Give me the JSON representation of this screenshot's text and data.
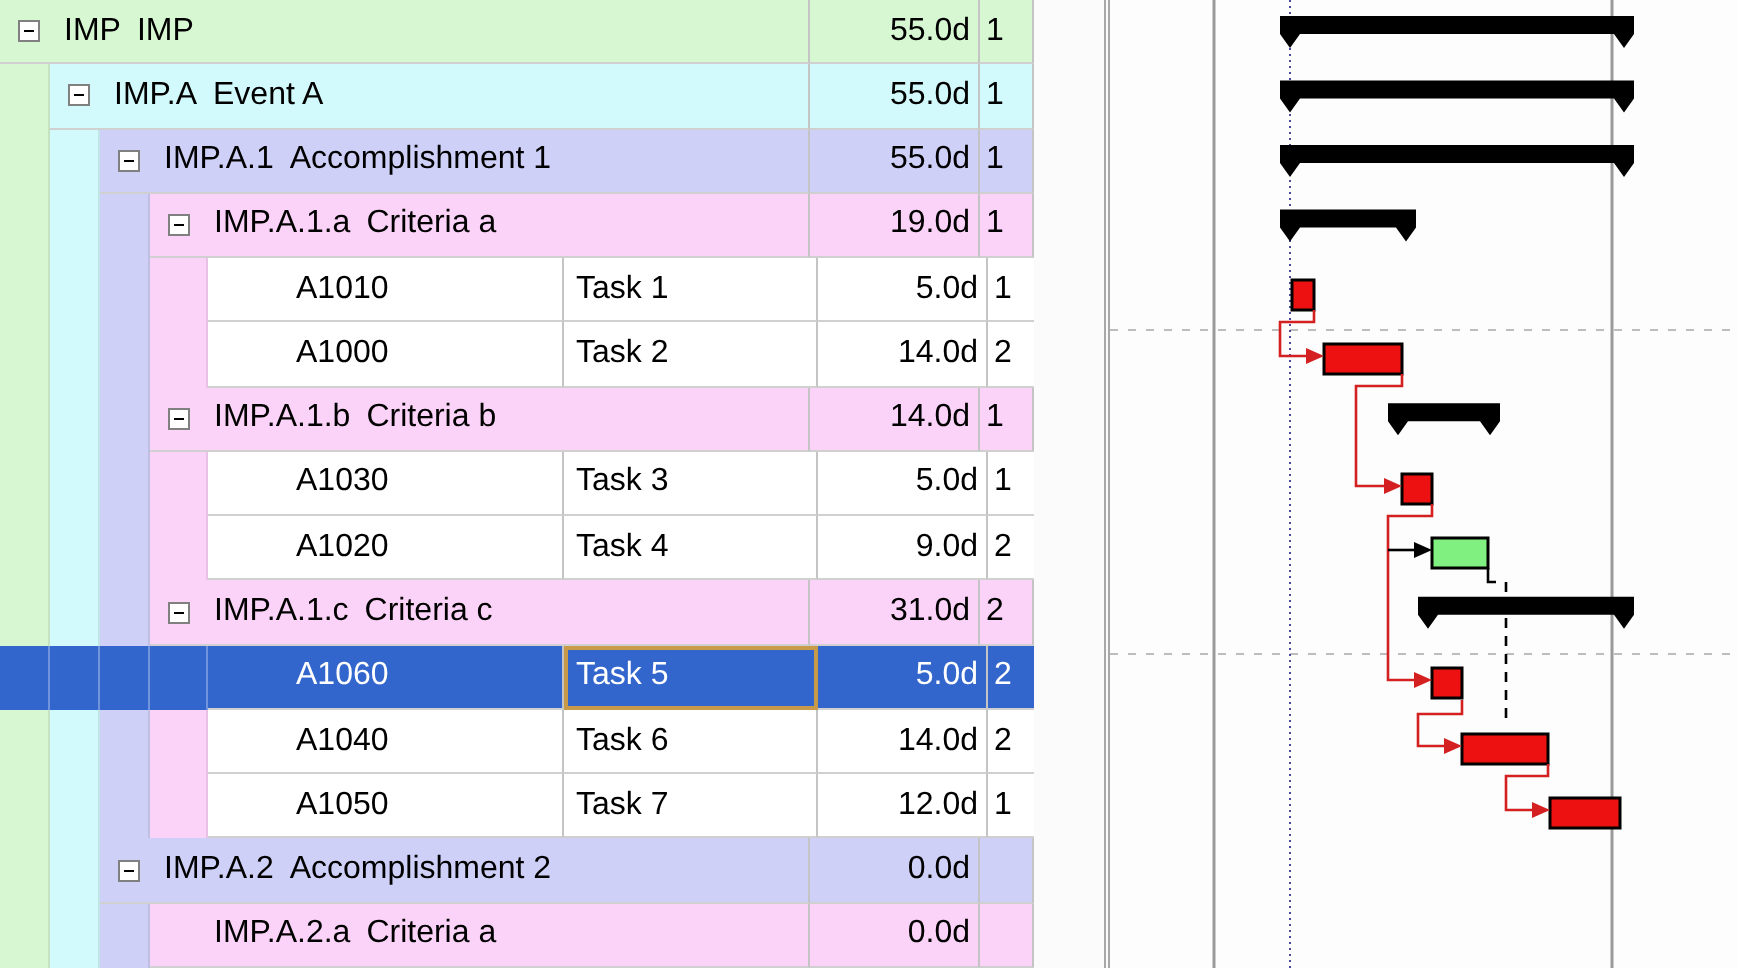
{
  "tree": [
    {
      "kind": "summary",
      "code": "IMP",
      "title": "IMP",
      "duration": "55.0d",
      "col_4": "1",
      "expanded": true,
      "selected": false,
      "children": [
        {
          "kind": "summary",
          "code": "IMP.A",
          "title": "Event A",
          "duration": "55.0d",
          "col_4": "1",
          "expanded": true,
          "selected": false,
          "children": [
            {
              "kind": "summary",
              "code": "IMP.A.1",
              "title": "Accomplishment 1",
              "duration": "55.0d",
              "col_4": "1",
              "expanded": true,
              "selected": false,
              "children": [
                {
                  "kind": "summary",
                  "code": "IMP.A.1.a",
                  "title": "Criteria a",
                  "duration": "19.0d",
                  "col_4": "1",
                  "expanded": true,
                  "selected": false,
                  "children": [
                    {
                      "kind": "task",
                      "code": "A1010",
                      "title": "Task 1",
                      "duration": "5.0d",
                      "col_4": "1",
                      "selected": false
                    },
                    {
                      "kind": "task",
                      "code": "A1000",
                      "title": "Task 2",
                      "duration": "14.0d",
                      "col_4": "2",
                      "selected": false
                    }
                  ]
                },
                {
                  "kind": "summary",
                  "code": "IMP.A.1.b",
                  "title": "Criteria b",
                  "duration": "14.0d",
                  "col_4": "1",
                  "expanded": true,
                  "selected": false,
                  "children": [
                    {
                      "kind": "task",
                      "code": "A1030",
                      "title": "Task 3",
                      "duration": "5.0d",
                      "col_4": "1",
                      "selected": false
                    },
                    {
                      "kind": "task",
                      "code": "A1020",
                      "title": "Task 4",
                      "duration": "9.0d",
                      "col_4": "2",
                      "selected": false
                    }
                  ]
                },
                {
                  "kind": "summary",
                  "code": "IMP.A.1.c",
                  "title": "Criteria c",
                  "duration": "31.0d",
                  "col_4": "2",
                  "expanded": true,
                  "selected": false,
                  "children": [
                    {
                      "kind": "task",
                      "code": "A1060",
                      "title": "Task 5",
                      "duration": "5.0d",
                      "col_4": "2",
                      "selected": true
                    },
                    {
                      "kind": "task",
                      "code": "A1040",
                      "title": "Task 6",
                      "duration": "14.0d",
                      "col_4": "2",
                      "selected": false
                    },
                    {
                      "kind": "task",
                      "code": "A1050",
                      "title": "Task 7",
                      "duration": "12.0d",
                      "col_4": "1",
                      "selected": false
                    }
                  ]
                }
              ]
            },
            {
              "kind": "summary",
              "code": "IMP.A.2",
              "title": "Accomplishment 2",
              "duration": "0.0d",
              "expanded": true,
              "selected": false,
              "children": [
                {
                  "kind": "summary",
                  "code": "IMP.A.2.a",
                  "title": "Criteria a",
                  "duration": "0.0d",
                  "selected": false
                }
              ]
            }
          ]
        }
      ]
    }
  ]
}
